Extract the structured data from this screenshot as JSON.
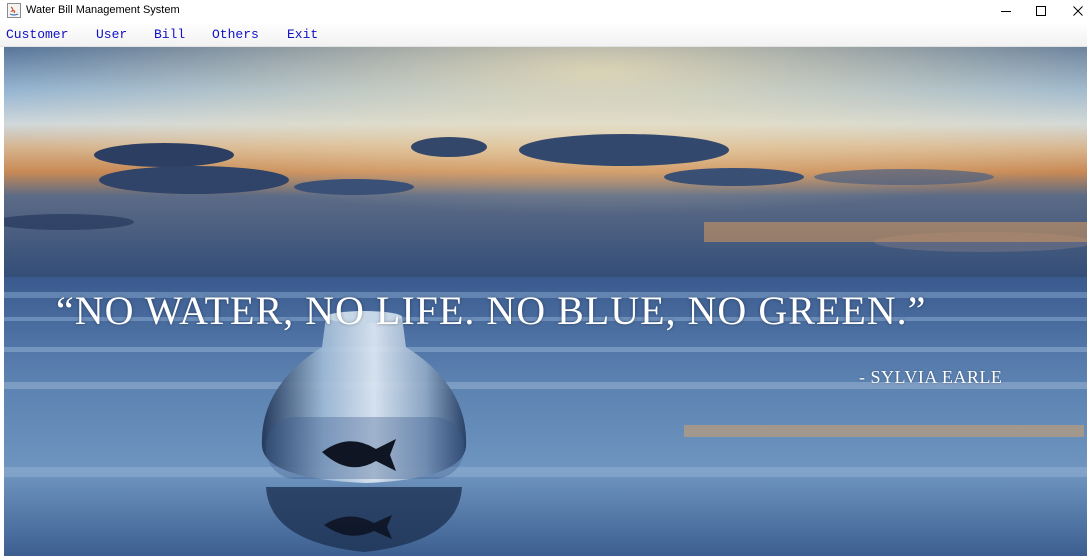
{
  "window": {
    "title": "Water Bill Management System",
    "controls": {
      "minimize": "minimize-icon",
      "maximize": "maximize-icon",
      "close": "close-icon"
    }
  },
  "menu": {
    "items": [
      {
        "label": "Customer"
      },
      {
        "label": "User"
      },
      {
        "label": "Bill"
      },
      {
        "label": "Others"
      },
      {
        "label": "Exit"
      }
    ],
    "color": "#1010c8"
  },
  "background": {
    "quote": "“NO WATER, NO LIFE. NO BLUE, NO GREEN.”",
    "author": "- SYLVIA EARLE"
  }
}
